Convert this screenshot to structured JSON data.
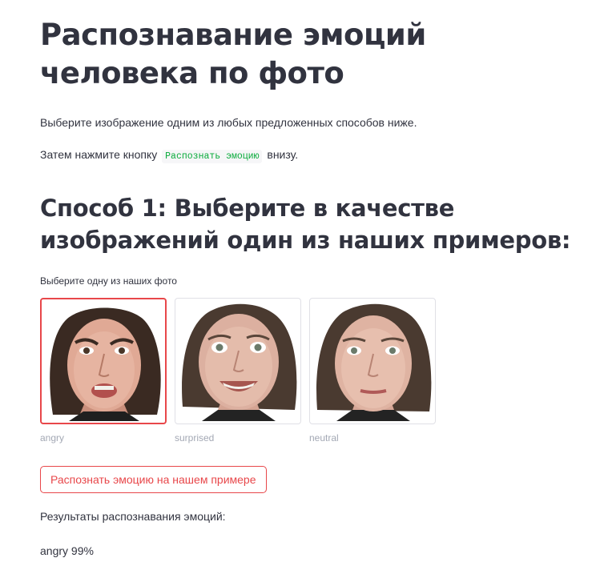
{
  "title": "Распознавание эмоций человека по фото",
  "intro": {
    "line1": "Выберите изображение одним из любых предложенных способов ниже.",
    "line2_before": "Затем нажмите кнопку",
    "line2_code": "Распознать эмоцию",
    "line2_after": "внизу."
  },
  "method1": {
    "heading": "Способ 1: Выберите в качестве изображений один из наших примеров:",
    "picker_label": "Выберите одну из наших фото",
    "images": [
      {
        "caption": "angry",
        "selected": true,
        "icon": "face-photo-angry"
      },
      {
        "caption": "surprised",
        "selected": false,
        "icon": "face-photo-smiling"
      },
      {
        "caption": "neutral",
        "selected": false,
        "icon": "face-photo-neutral"
      }
    ],
    "button_label": "Распознать эмоцию на нашем примере"
  },
  "results": {
    "label": "Результаты распознавания эмоций:",
    "value": "angry 99%"
  },
  "colors": {
    "accent": "#e8474a",
    "text": "#31333f",
    "code": "#09ab3b",
    "caption": "#a3a8b4"
  }
}
